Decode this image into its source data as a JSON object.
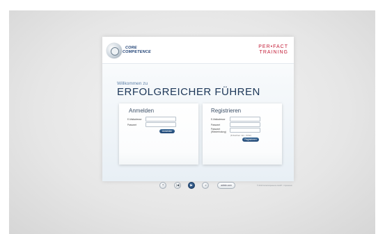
{
  "header": {
    "logo_line1": "CORE",
    "logo_line2": "COMPETENCE",
    "brand_line1": "PER•FACT",
    "brand_line2": "TRAINING"
  },
  "intro": {
    "welcome": "Willkommen zu",
    "headline": "ERFOLGREICHER FÜHREN"
  },
  "login": {
    "title": "Anmelden",
    "email_label": "E-Mailadresse",
    "password_label": "Passwort",
    "submit_label": "Anmelden"
  },
  "register": {
    "title": "Registrieren",
    "email_label": "E-Mailadresse",
    "password_label": "Passwort",
    "password_repeat_label": "Passwort (Wiederholung)",
    "note": "(8 Zeichen min., Kl/Gr)",
    "submit_label": "Registrieren"
  },
  "controls": {
    "help_icon": "help-icon",
    "back_icon": "skip-back-icon",
    "play_icon": "play-icon",
    "volume_icon": "volume-icon",
    "pill_label": "admin.com",
    "footer": "© 2013 CoreCompetence GmbH · Impressum"
  },
  "colors": {
    "brand_blue": "#1d3f73",
    "brand_red": "#c4203a",
    "button_blue": "#1d4372"
  }
}
